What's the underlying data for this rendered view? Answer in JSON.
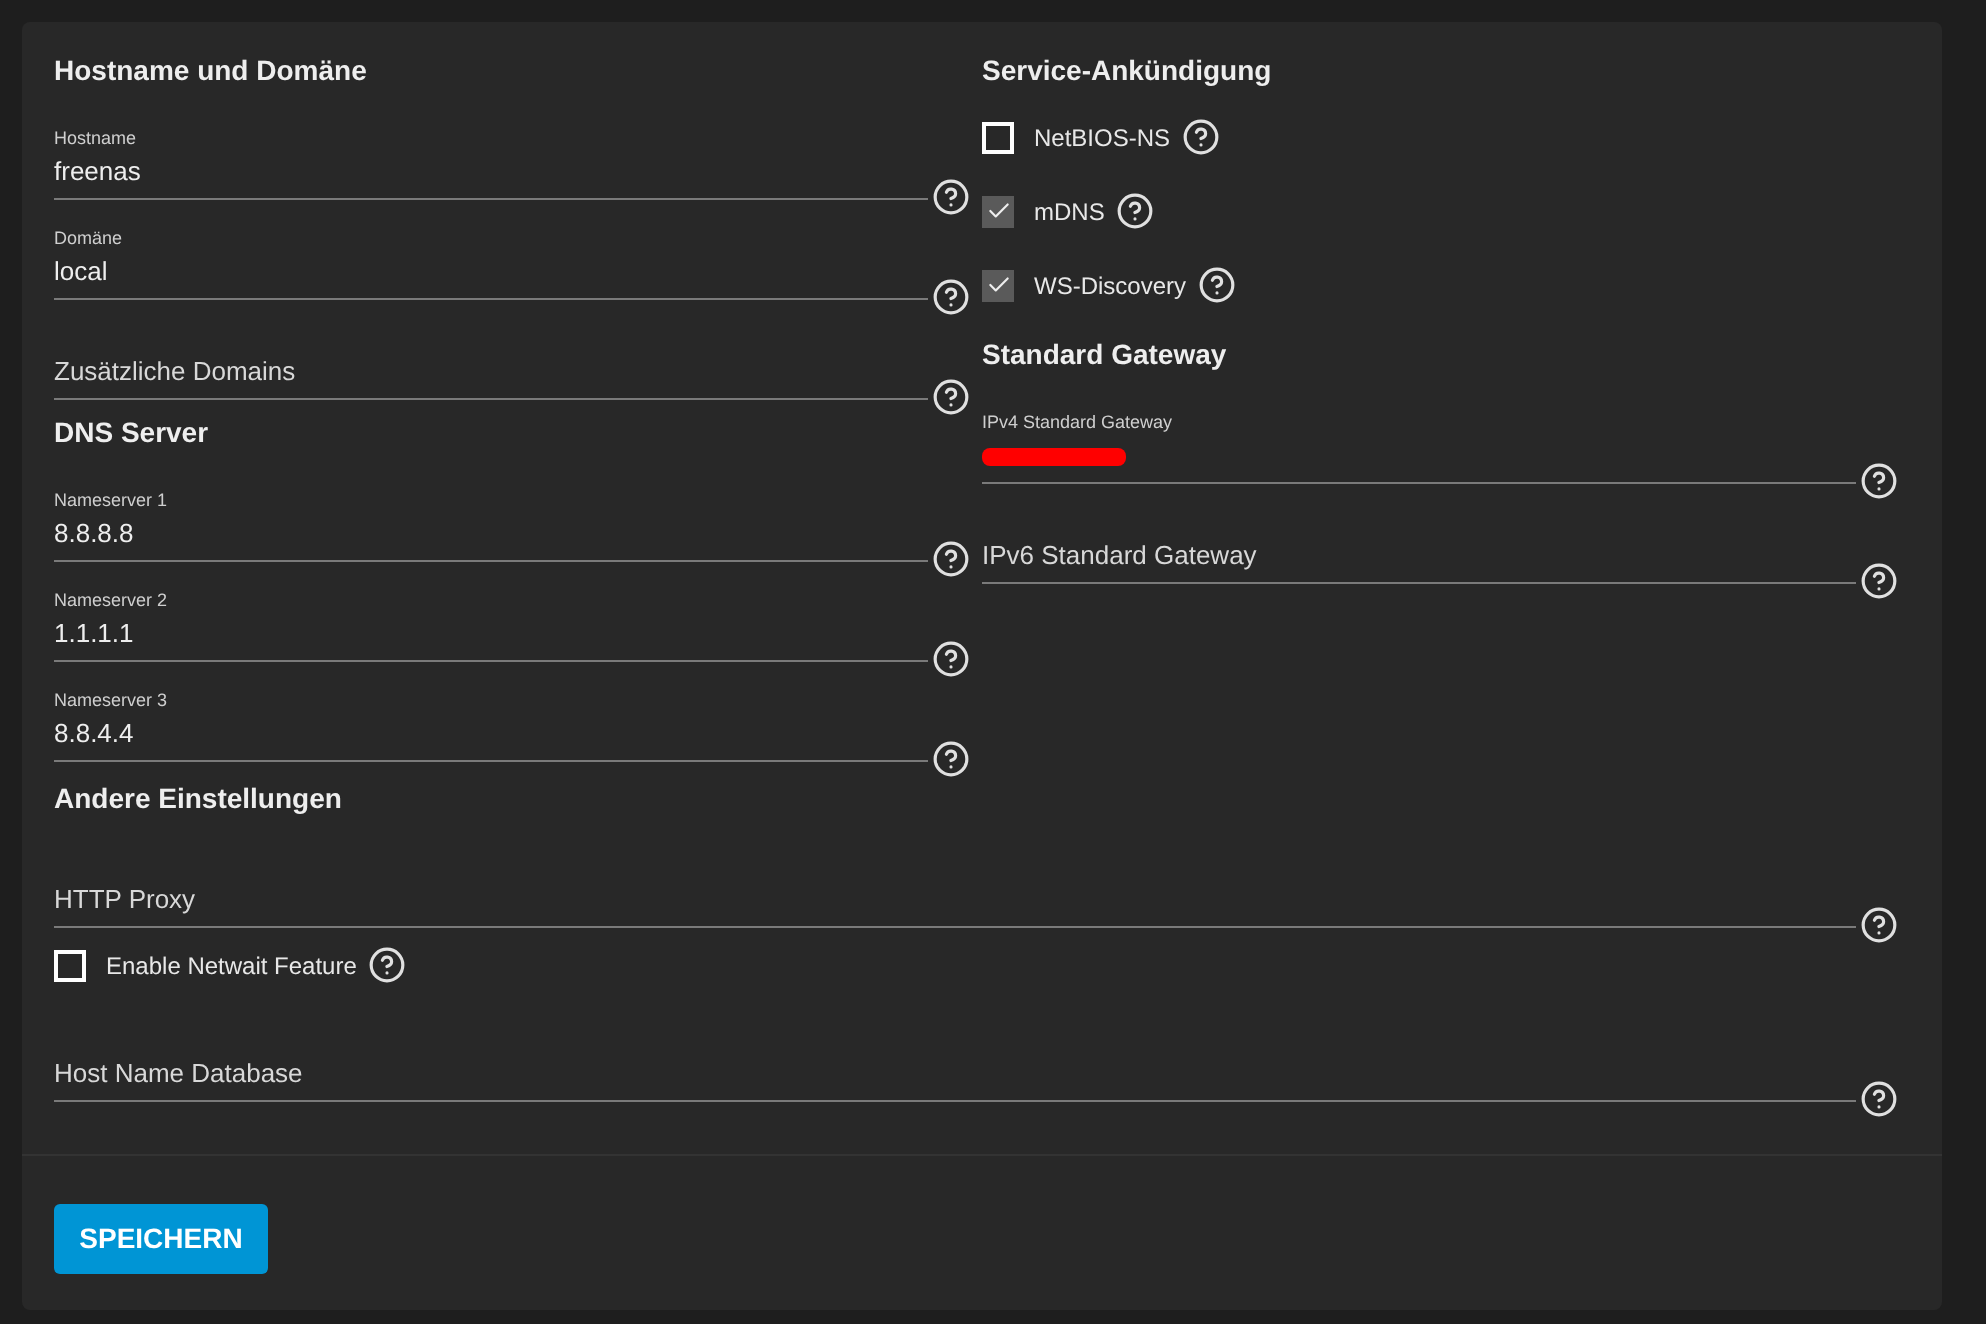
{
  "columns": [
    {
      "sections": [
        {
          "title": "Hostname und Domäne",
          "items": [
            {
              "kind": "field",
              "label": "Hostname",
              "value": "freenas"
            },
            {
              "kind": "field",
              "label": "Domäne",
              "value": "local"
            },
            {
              "kind": "field",
              "placeholder": "Zusätzliche Domains"
            }
          ]
        },
        {
          "title": "DNS Server",
          "items": [
            {
              "kind": "field",
              "label": "Nameserver 1",
              "value": "8.8.8.8"
            },
            {
              "kind": "field",
              "label": "Nameserver 2",
              "value": "1.1.1.1"
            },
            {
              "kind": "field",
              "label": "Nameserver 3",
              "value": "8.8.4.4"
            }
          ]
        }
      ]
    },
    {
      "sections": [
        {
          "title": "Service-Ankündigung",
          "items": [
            {
              "kind": "checkbox",
              "label": "NetBIOS-NS",
              "checked": false
            },
            {
              "kind": "checkbox",
              "label": "mDNS",
              "checked": true
            },
            {
              "kind": "checkbox",
              "label": "WS-Discovery",
              "checked": true
            }
          ]
        },
        {
          "title": "Standard Gateway",
          "items": [
            {
              "kind": "field",
              "label": "IPv4 Standard Gateway",
              "redacted": true
            },
            {
              "kind": "field",
              "placeholder": "IPv6 Standard Gateway"
            }
          ]
        }
      ]
    }
  ],
  "other": {
    "title": "Andere Einstellungen",
    "items": [
      {
        "kind": "field",
        "placeholder": "HTTP Proxy"
      },
      {
        "kind": "checkbox",
        "label": "Enable Netwait Feature",
        "checked": false
      },
      {
        "kind": "field",
        "placeholder": "Host Name Database"
      }
    ]
  },
  "save_button": "SPEICHERN"
}
